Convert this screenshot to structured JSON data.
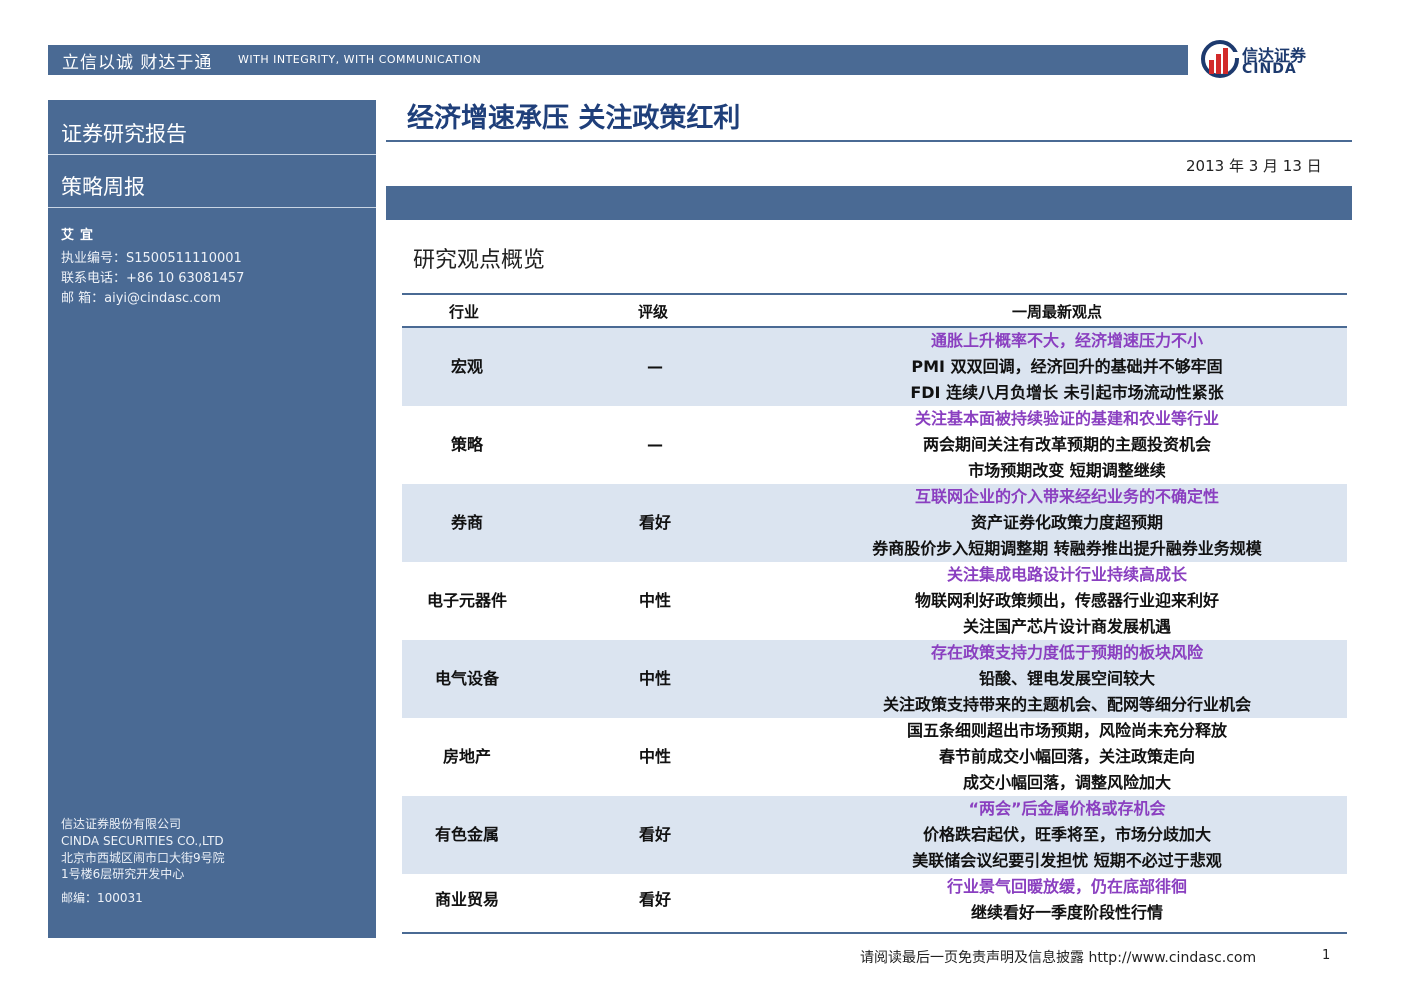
{
  "header": {
    "slogan_cn": "立信以诚  财达于通",
    "slogan_en": "WITH INTEGRITY, WITH COMMUNICATION",
    "logo_cn": "信达证券",
    "logo_en": "CINDA"
  },
  "sidebar": {
    "title": "证券研究报告",
    "subtitle": "策略周报",
    "author": "艾宜",
    "license": "执业编号：S1500511110001",
    "phone": "联系电话：+86 10 63081457",
    "email": "邮    箱：aiyi@cindasc.com",
    "company_cn": "信达证券股份有限公司",
    "company_en": "CINDA SECURITIES CO.,LTD",
    "address1": "北京市西城区闹市口大街9号院",
    "address2": "1号楼6层研究开发中心",
    "postcode": "邮编：100031"
  },
  "main": {
    "title": "经济增速承压  关注政策红利",
    "date": "2013 年 3 月 13 日",
    "section_title": "研究观点概览"
  },
  "table": {
    "headers": [
      "行业",
      "评级",
      "一周最新观点"
    ],
    "rows": [
      {
        "industry": "宏观",
        "rating": "—",
        "views": [
          "通胀上升概率不大，经济增速压力不小",
          "PMI 双双回调，经济回升的基础并不够牢固",
          "FDI 连续八月负增长  未引起市场流动性紧张"
        ]
      },
      {
        "industry": "策略",
        "rating": "—",
        "views": [
          "关注基本面被持续验证的基建和农业等行业",
          "两会期间关注有改革预期的主题投资机会",
          "市场预期改变  短期调整继续"
        ]
      },
      {
        "industry": "券商",
        "rating": "看好",
        "views": [
          "互联网企业的介入带来经纪业务的不确定性",
          "资产证券化政策力度超预期",
          "券商股价步入短期调整期  转融券推出提升融券业务规模"
        ]
      },
      {
        "industry": "电子元器件",
        "rating": "中性",
        "views": [
          "关注集成电路设计行业持续高成长",
          "物联网利好政策频出，传感器行业迎来利好",
          "关注国产芯片设计商发展机遇"
        ]
      },
      {
        "industry": "电气设备",
        "rating": "中性",
        "views": [
          "存在政策支持力度低于预期的板块风险",
          "铅酸、锂电发展空间较大",
          "关注政策支持带来的主题机会、配网等细分行业机会"
        ]
      },
      {
        "industry": "房地产",
        "rating": "中性",
        "views": [
          "国五条细则超出市场预期，风险尚未充分释放",
          "春节前成交小幅回落，关注政策走向",
          "成交小幅回落，调整风险加大"
        ]
      },
      {
        "industry": "有色金属",
        "rating": "看好",
        "views": [
          "“两会”后金属价格或存机会",
          "价格跌宕起伏，旺季将至，市场分歧加大",
          "美联储会议纪要引发担忧  短期不必过于悲观"
        ]
      },
      {
        "industry": "商业贸易",
        "rating": "看好",
        "views": [
          "行业景气回暖放缓，仍在底部徘徊",
          "继续看好一季度阶段性行情"
        ]
      }
    ]
  },
  "footer": {
    "disclaimer": "请阅读最后一页免责声明及信息披露 http://www.cindasc.com",
    "page": "1"
  }
}
